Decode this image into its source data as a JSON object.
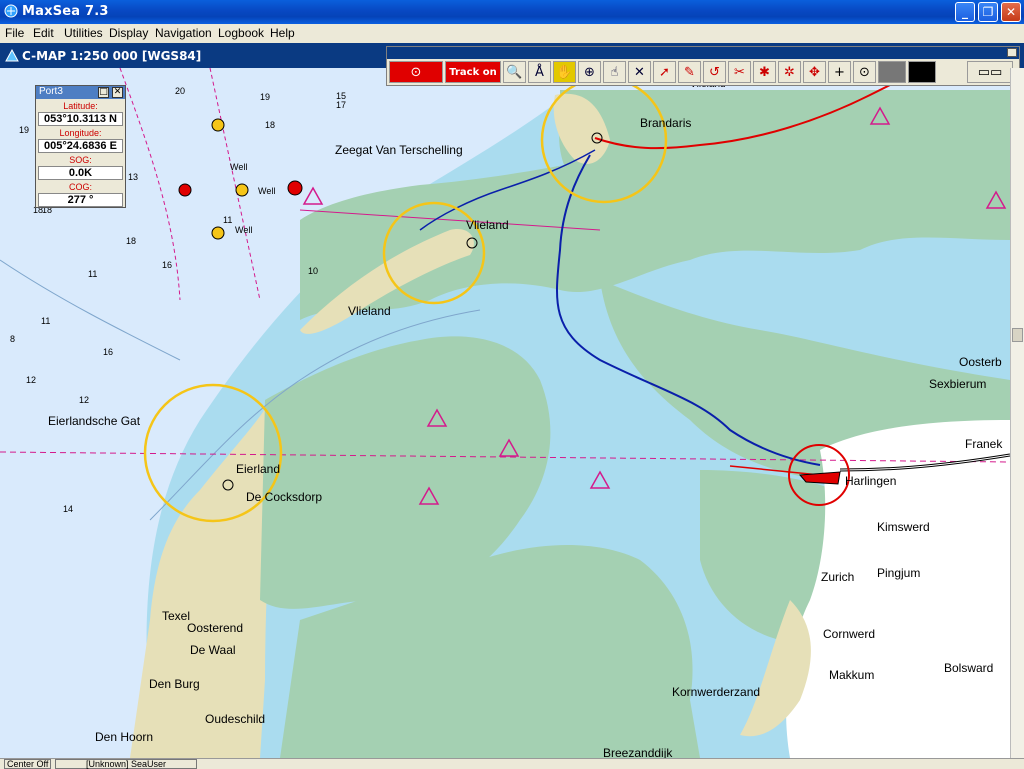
{
  "window": {
    "title": "MaxSea 7.3"
  },
  "menu": [
    "File",
    "Edit",
    "Utilities",
    "Display",
    "Navigation",
    "Logbook",
    "Help"
  ],
  "chart_header": "C-MAP  1:250 000 [WGS84]",
  "toolbar": {
    "track_label": "Track on"
  },
  "port_window": {
    "title": "Port3",
    "lat_label": "Latitude:",
    "lat_value": "053°10.3113 N",
    "lon_label": "Longitude:",
    "lon_value": "005°24.6836 E",
    "sog_label": "SOG:",
    "sog_value": "0.0K",
    "cog_label": "COG:",
    "cog_value": "277 °"
  },
  "places": [
    "Vlieland",
    "Vlieland",
    "Zeegat Van Terschelling",
    "Brandaris",
    "Vlieland",
    "Eierlandsche Gat",
    "Eierland",
    "De Cocksdorp",
    "Harlingen",
    "Kimswerd",
    "Zurich",
    "Pingjum",
    "Cornwerd",
    "Makkum",
    "Bolsward",
    "Oosterb",
    "Sexbierum",
    "Franek",
    "Texel",
    "Oosterend",
    "De Waal",
    "Den Burg",
    "Oudeschild",
    "Den Hoorn",
    "Kornwerderzand",
    "Breezanddijk"
  ],
  "depth_marks": [
    "20",
    "19",
    "17",
    "15",
    "18",
    "18",
    "16",
    "11",
    "11",
    "18",
    "13",
    "8",
    "10",
    "12",
    "12",
    "11",
    "14",
    "16",
    "19",
    "18"
  ],
  "buoy_labels": [
    "Well",
    "Well",
    "Well"
  ],
  "status": {
    "left": "Center Off",
    "mid": "[Unknown] SeaUser"
  },
  "colors": {
    "land": "#a4d0b2",
    "shallow": "#aadcef",
    "deep": "#d9eafc",
    "dry": "#e6e0b8",
    "track_blue": "#0a1faa",
    "track_red": "#e00000",
    "highlight": "#f5c518"
  }
}
